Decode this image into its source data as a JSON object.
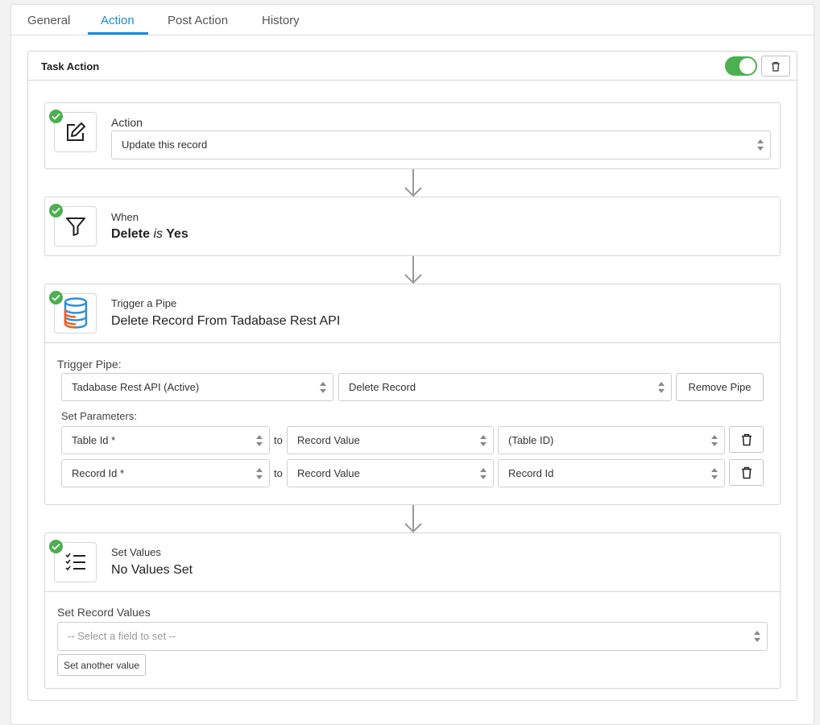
{
  "tabs": [
    "General",
    "Action",
    "Post Action",
    "History"
  ],
  "active_tab": "Action",
  "card": {
    "title": "Task Action",
    "toggle_on": true
  },
  "steps": {
    "action": {
      "label": "Action",
      "select_value": "Update this record"
    },
    "when": {
      "label": "When",
      "field": "Delete",
      "operator": "is",
      "value": "Yes"
    },
    "pipe": {
      "label": "Trigger a Pipe",
      "value": "Delete Record From Tadabase Rest API",
      "trigger_pipe_label": "Trigger Pipe:",
      "pipe_select": "Tadabase Rest API (Active)",
      "call_select": "Delete Record",
      "remove_button": "Remove Pipe",
      "set_params_label": "Set Parameters:",
      "params": [
        {
          "param": "Table Id *",
          "to": "to",
          "source": "Record Value",
          "value": "(Table ID)"
        },
        {
          "param": "Record Id *",
          "to": "to",
          "source": "Record Value",
          "value": "Record Id"
        }
      ]
    },
    "values": {
      "label": "Set Values",
      "value": "No Values Set",
      "set_record_label": "Set Record Values",
      "field_placeholder": "-- Select a field to set --",
      "another_button": "Set another value"
    }
  },
  "colors": {
    "accent": "#1a8cd8",
    "success": "#4caf50",
    "db_blue": "#2f8fd8",
    "db_orange": "#e8622a"
  },
  "icons": [
    "trash-icon",
    "edit-icon",
    "filter-icon",
    "database-icon",
    "checklist-icon",
    "check-icon",
    "arrow-down-icon",
    "select-arrows-icon"
  ]
}
